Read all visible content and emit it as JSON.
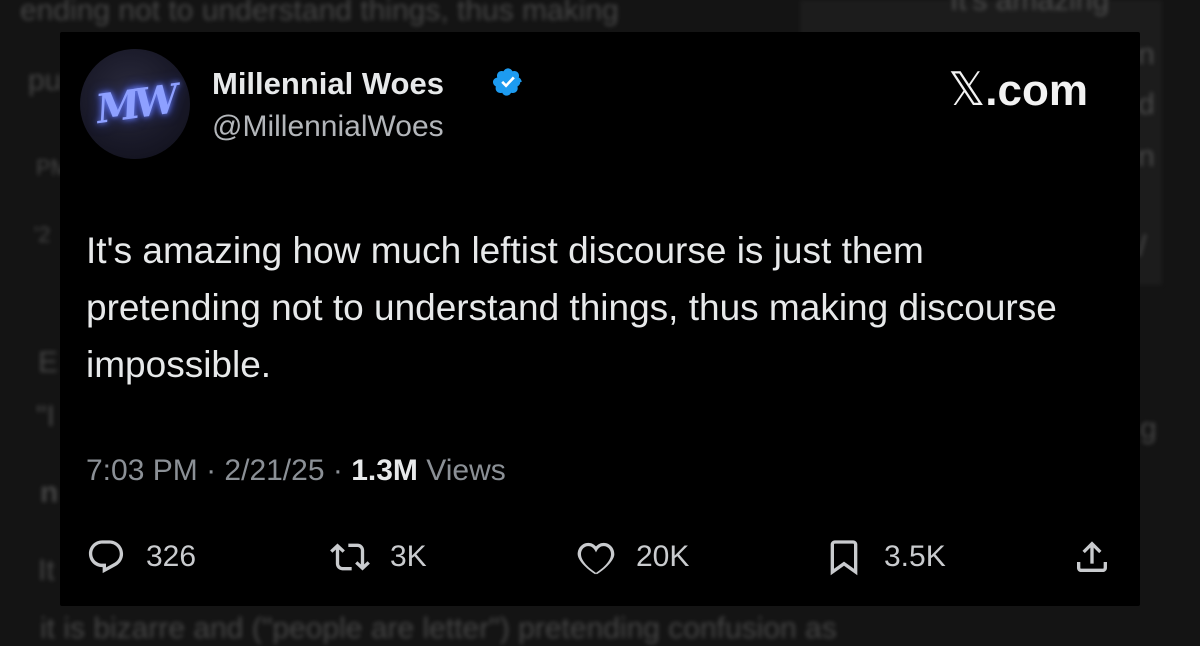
{
  "background": {
    "lines": [
      "ending not to understand things, thus making",
      "pu",
      "PM",
      "'2",
      "E",
      "\"I",
      "n",
      "It",
      "it is bizarre and (\"people are letter\") pretending confusion as"
    ],
    "panel_lines": [
      "It's amazing",
      "n",
      "d",
      "n",
      "/"
    ],
    "right_edge_letter": "g"
  },
  "tweet": {
    "avatar_text": "MW",
    "display_name": "Millennial Woes",
    "handle": "@MillennialWoes",
    "brand": "X.com",
    "brand_x": "𝕏",
    "brand_suffix": ".com",
    "text": "It's amazing how much leftist discourse is just them pretending not to understand things, thus making discourse impossible.",
    "time": "7:03 PM",
    "date": "2/21/25",
    "separator": "·",
    "views_count": "1.3M",
    "views_label": "Views",
    "replies": "326",
    "reposts": "3K",
    "likes": "20K",
    "bookmarks": "3.5K"
  },
  "colors": {
    "verified": "#1d9bf0",
    "card_background": "#000000",
    "text": "#e7e9ea",
    "muted": "#8b9096"
  },
  "icons": [
    "verified-badge-icon",
    "reply-icon",
    "repost-icon",
    "like-icon",
    "bookmark-icon",
    "share-icon"
  ]
}
